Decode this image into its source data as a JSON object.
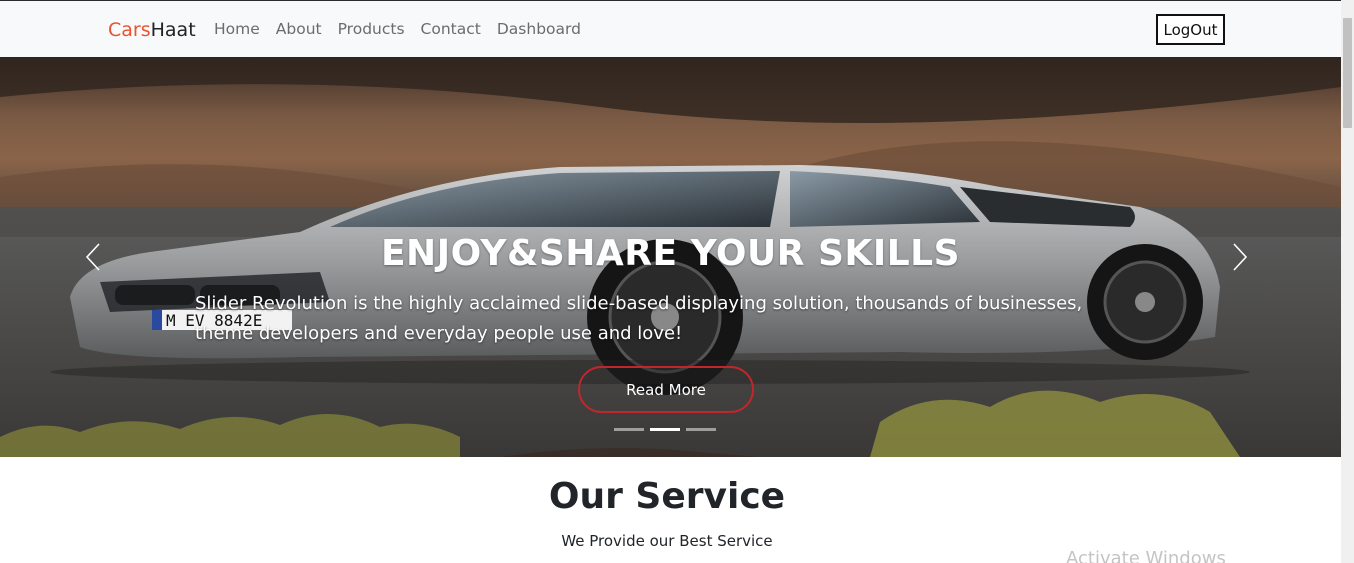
{
  "navbar": {
    "brand_part1": "Cars",
    "brand_part2": "Haat",
    "links": [
      "Home",
      "About",
      "Products",
      "Contact",
      "Dashboard"
    ],
    "logout_label": "LogOut"
  },
  "hero": {
    "title": "ENJOY&SHARE YOUR SKILLS",
    "text": "Slider Revolution is the highly acclaimed slide-based displaying solution, thousands of businesses, theme developers and everyday people use and love!",
    "button_label": "Read More",
    "active_slide": 2,
    "slide_count": 3,
    "plate_text": "M EV 8842E"
  },
  "section": {
    "title": "Our Service",
    "subtitle": "We Provide our Best Service"
  },
  "watermark": "Activate Windows",
  "colors": {
    "brand_accent": "#e8542e",
    "button_border": "#c0272d",
    "navbar_bg": "#f8f9fa"
  }
}
